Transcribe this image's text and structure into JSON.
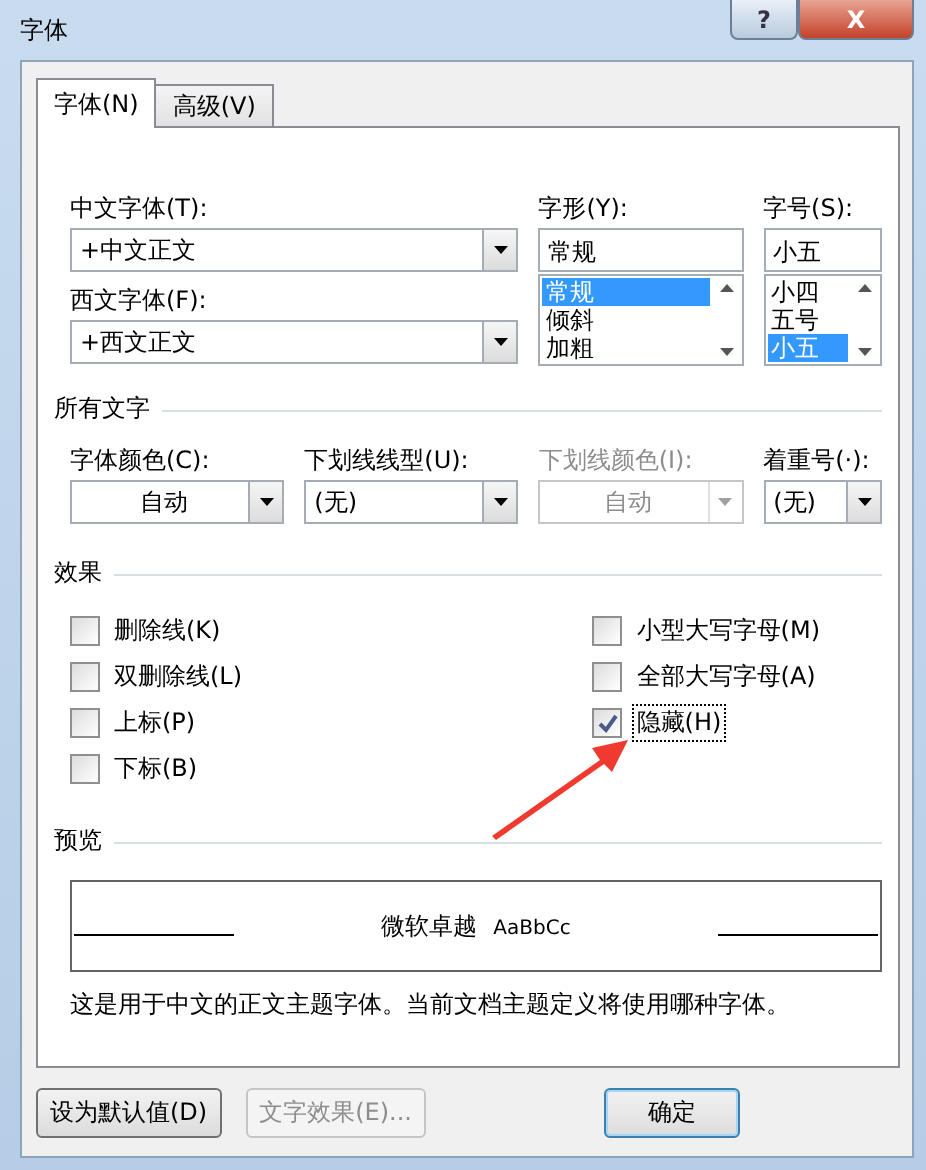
{
  "window": {
    "title": "字体",
    "help_button": "?",
    "close_button": "X"
  },
  "tabs": [
    {
      "label": "字体(N)",
      "selected": true
    },
    {
      "label": "高级(V)",
      "selected": false
    }
  ],
  "chinese_font": {
    "label": "中文字体(T):",
    "value": "+中文正文"
  },
  "western_font": {
    "label": "西文字体(F):",
    "value": "+西文正文"
  },
  "style": {
    "label": "字形(Y):",
    "value": "常规",
    "options": [
      {
        "label": "常规",
        "selected": true
      },
      {
        "label": "倾斜",
        "selected": false
      },
      {
        "label": "加粗",
        "selected": false
      }
    ]
  },
  "size": {
    "label": "字号(S):",
    "value": "小五",
    "options": [
      {
        "label": "小四",
        "selected": false
      },
      {
        "label": "五号",
        "selected": false
      },
      {
        "label": "小五",
        "selected": true
      }
    ]
  },
  "all_text": {
    "heading": "所有文字",
    "fields": [
      {
        "label": "字体颜色(C):",
        "value": "自动",
        "disabled": false,
        "centered": true
      },
      {
        "label": "下划线线型(U):",
        "value": "(无)",
        "disabled": false,
        "centered": false
      },
      {
        "label": "下划线颜色(I):",
        "value": "自动",
        "disabled": true,
        "centered": true
      },
      {
        "label": "着重号(·):",
        "value": "(无)",
        "disabled": false,
        "centered": false
      }
    ]
  },
  "effects": {
    "heading": "效果",
    "left": [
      {
        "label": "删除线(K)",
        "checked": false,
        "focused": false
      },
      {
        "label": "双删除线(L)",
        "checked": false,
        "focused": false
      },
      {
        "label": "上标(P)",
        "checked": false,
        "focused": false
      },
      {
        "label": "下标(B)",
        "checked": false,
        "focused": false
      }
    ],
    "right": [
      {
        "label": "小型大写字母(M)",
        "checked": false,
        "focused": false
      },
      {
        "label": "全部大写字母(A)",
        "checked": false,
        "focused": false
      },
      {
        "label": "隐藏(H)",
        "checked": true,
        "focused": true
      }
    ]
  },
  "preview": {
    "heading": "预览",
    "sample_cjk": "微软卓越",
    "sample_latin": "AaBbCc",
    "description": "这是用于中文的正文主题字体。当前文档主题定义将使用哪种字体。"
  },
  "buttons": [
    {
      "label": "设为默认值(D)",
      "disabled": false,
      "default": false
    },
    {
      "label": "文字效果(E)...",
      "disabled": true,
      "default": false
    },
    {
      "label": "确定",
      "disabled": false,
      "default": true
    }
  ]
}
